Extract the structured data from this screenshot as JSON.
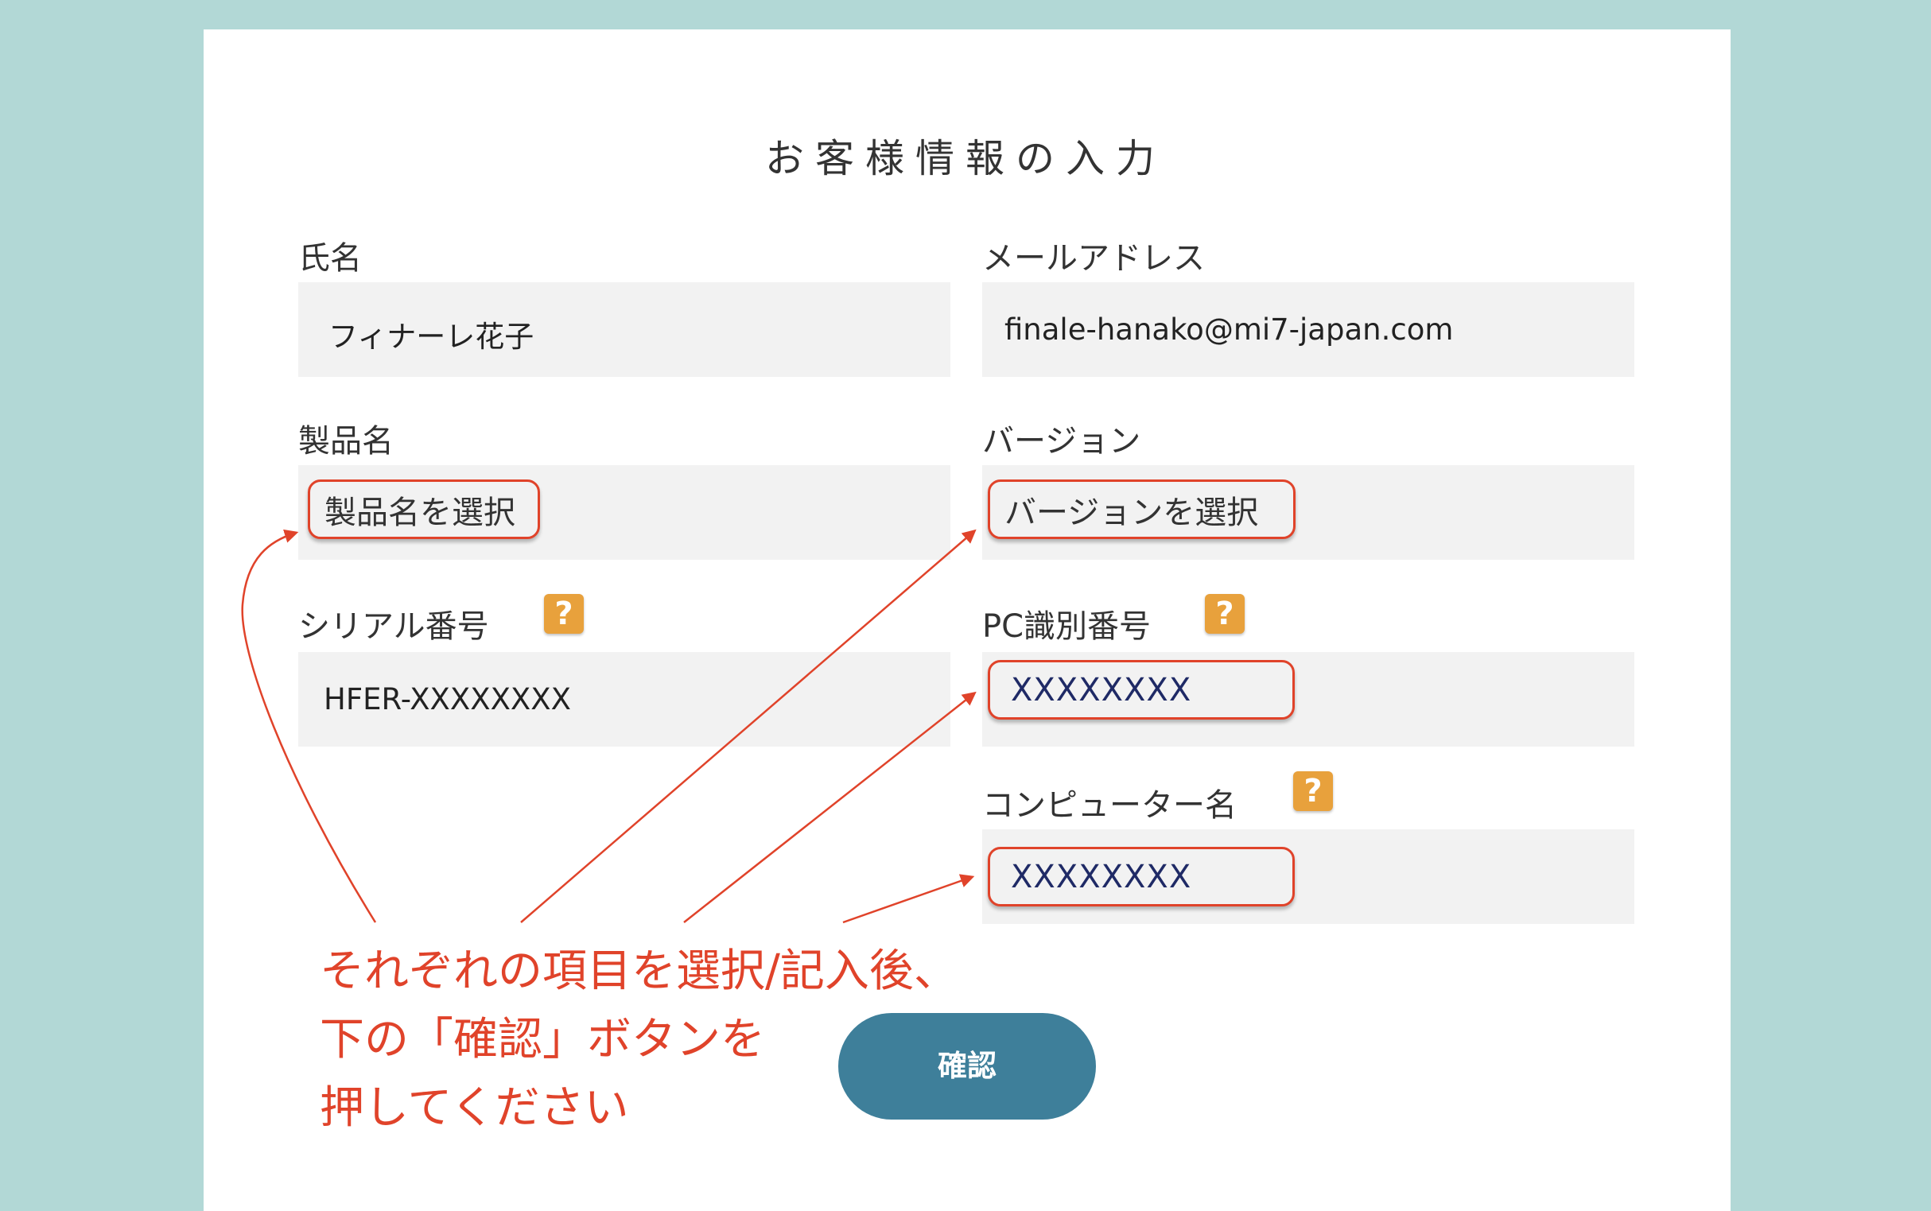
{
  "form": {
    "title": "お客様情報の入力",
    "name": {
      "label": "氏名",
      "value": "フィナーレ花子"
    },
    "email": {
      "label": "メールアドレス",
      "value": "finale-hanako@mi7-japan.com"
    },
    "product": {
      "label": "製品名",
      "select_text": "製品名を選択"
    },
    "version": {
      "label": "バージョン",
      "select_text": "バージョンを選択"
    },
    "serial": {
      "label": "シリアル番号",
      "value": "HFER-XXXXXXXX"
    },
    "pc_id": {
      "label": "PC識別番号",
      "value": "XXXXXXXX"
    },
    "computer_name": {
      "label": "コンピューター名",
      "value": "XXXXXXXX"
    },
    "help_glyph": "?",
    "confirm_label": "確認"
  },
  "annotation": {
    "lines": [
      "それぞれの項目を選択/記入後、",
      "下の「確認」ボタンを",
      "押してください"
    ],
    "color": "#e0432a"
  },
  "colors": {
    "background": "#b2d8d6",
    "panel": "#ffffff",
    "field": "#f2f2f2",
    "button": "#3e7f9a",
    "help_icon": "#e8a13c",
    "annotation": "#e0432a"
  }
}
